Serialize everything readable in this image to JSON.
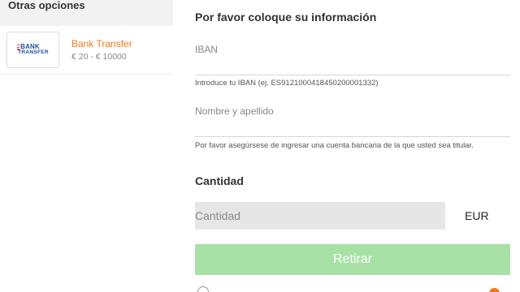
{
  "sidebar": {
    "header": "Otras opciones",
    "methods": [
      {
        "name": "Bank Transfer",
        "range": "€ 20 - € 10000",
        "logo_top": "BANK",
        "logo_bottom": "TRANSFER",
        "logo_icon": "bank-transfer-logo"
      }
    ]
  },
  "form": {
    "title": "Por favor coloque su información",
    "iban": {
      "placeholder": "IBAN",
      "value": "",
      "hint": "Introduce tu IBAN (ej. ES9121000418450200001332)"
    },
    "name": {
      "placeholder": "Nombre y apellido",
      "value": "",
      "hint": "Por favor asegúrsese de ingresar una cuenta bancaria de la que usted sea titular."
    },
    "amount": {
      "label": "Cantidad",
      "placeholder": "Cantidad",
      "value": "",
      "currency": "EUR"
    },
    "submit_label": "Retirar"
  },
  "colors": {
    "accent_orange": "#f07a1a",
    "submit_green_disabled": "#a8e1a6",
    "header_bg": "#f2f2f2",
    "amount_bg": "#e6e6e6"
  }
}
